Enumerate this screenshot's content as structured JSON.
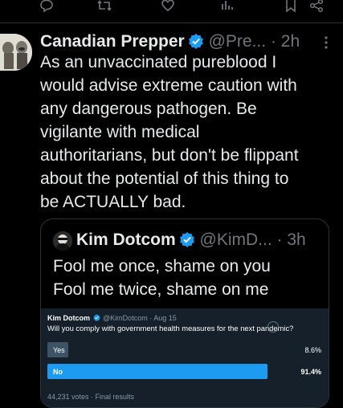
{
  "colors": {
    "background": "#000000",
    "text": "#e7e9ea",
    "muted": "#71767b",
    "verified": "#1d9bf0",
    "border": "#2f3336",
    "poll_bg": "#15202b",
    "poll_winner": "#1d9bf0",
    "poll_loser": "#3d5466"
  },
  "top_actions": [
    {
      "icon": "reply-icon"
    },
    {
      "icon": "retweet-icon"
    },
    {
      "icon": "like-icon"
    },
    {
      "icon": "views-icon"
    },
    {
      "icon": "bookmark-icon"
    },
    {
      "icon": "share-icon"
    }
  ],
  "tweet": {
    "display_name": "Canadian Prepper",
    "handle": "@Pre...",
    "separator": "·",
    "time": "2h",
    "text": "As an unvaccinated pureblood I\nwould advise extreme caution with\nany dangerous pathogen. Be\nvigilante with medical\nauthoritarians, but don't be flippant\nabout the potential of this thing to\nbe ACTUALLY bad."
  },
  "quote": {
    "display_name": "Kim Dotcom",
    "handle": "@KimD...",
    "separator": "·",
    "time": "3h",
    "text": "Fool me once, shame on you\nFool me twice, shame on me",
    "embedded_poll": {
      "name": "Kim Dotcom",
      "handle": "@KimDotcom",
      "separator": "·",
      "date": "Aug 15",
      "question": "Will you comply with government health measures for the next pandemic?",
      "options": [
        {
          "label": "Yes",
          "percent_text": "8.6%",
          "percent": 8.6,
          "winner": false
        },
        {
          "label": "No",
          "percent_text": "91.4%",
          "percent": 91.4,
          "winner": true
        }
      ],
      "footer": "44,231 votes · Final results"
    }
  }
}
